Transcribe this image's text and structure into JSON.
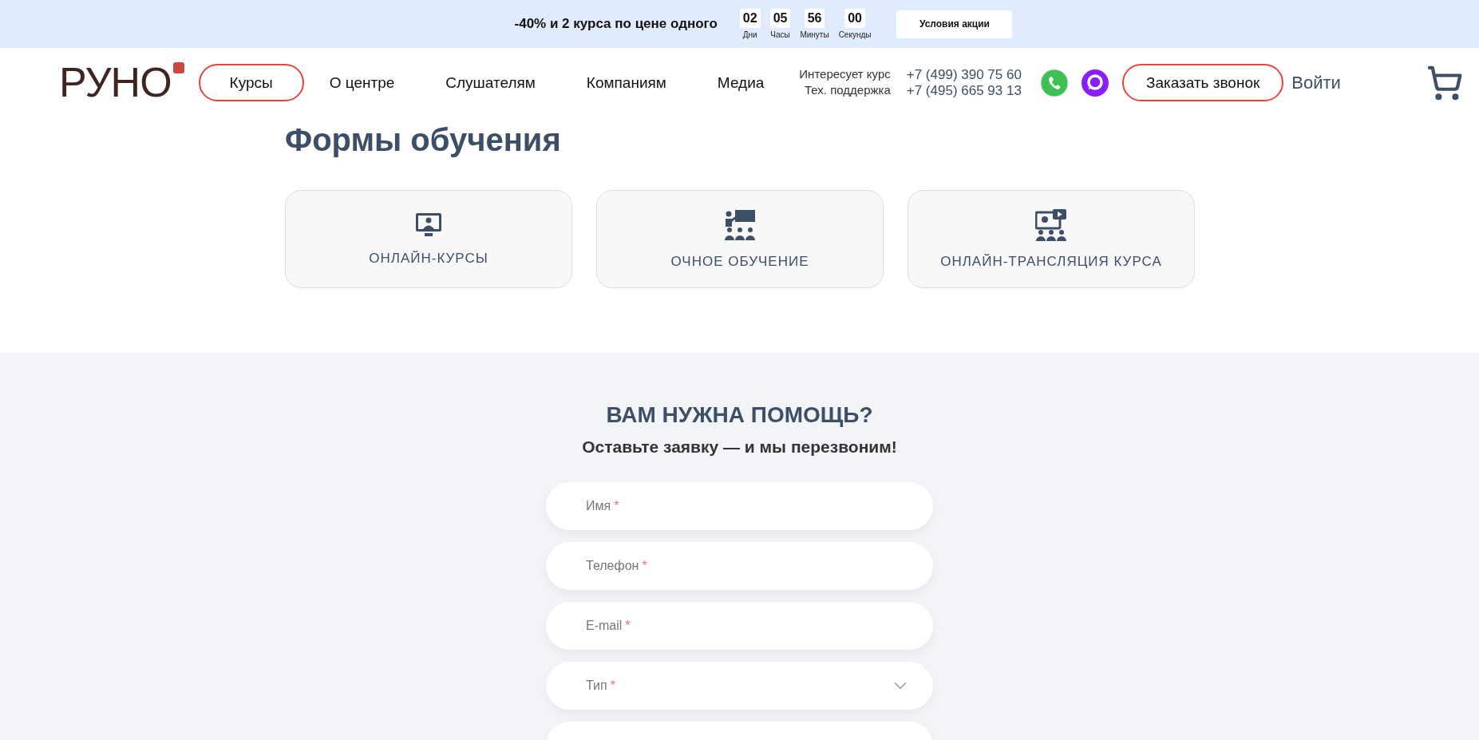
{
  "promo": {
    "text": "-40% и 2 курса по цене одного",
    "timer": [
      {
        "value": "02",
        "label": "Дни"
      },
      {
        "value": "05",
        "label": "Часы"
      },
      {
        "value": "56",
        "label": "Минуты"
      },
      {
        "value": "00",
        "label": "Секунды"
      }
    ],
    "button": "Условия акции"
  },
  "header": {
    "logo": "РУНО",
    "nav": [
      {
        "label": "Курсы",
        "selected": true
      },
      {
        "label": "О центре",
        "selected": false
      },
      {
        "label": "Слушателям",
        "selected": false
      },
      {
        "label": "Компаниям",
        "selected": false
      },
      {
        "label": "Медиа",
        "selected": false
      }
    ],
    "contacts": [
      {
        "label": "Интересует курс",
        "phone": "+7 (499) 390 75 60"
      },
      {
        "label": "Тех. поддержка",
        "phone": "+7 (495) 665 93 13"
      }
    ],
    "call_button": "Заказать звонок",
    "login": "Войти"
  },
  "learning_forms": {
    "title": "Формы обучения",
    "cards": [
      {
        "kind": "online",
        "label": "ОНЛАЙН-КУРСЫ"
      },
      {
        "kind": "classroom",
        "label": "ОЧНОЕ ОБУЧЕНИЕ"
      },
      {
        "kind": "stream",
        "label": "ОНЛАЙН-ТРАНСЛЯЦИЯ КУРСА"
      }
    ]
  },
  "help": {
    "title": "ВАМ НУЖНА ПОМОЩЬ?",
    "subtitle": "Оставьте заявку — и мы перезвоним!",
    "fields": [
      {
        "kind": "text",
        "placeholder": "Имя",
        "mark": "*"
      },
      {
        "kind": "text",
        "placeholder": "Телефон",
        "mark": "*"
      },
      {
        "kind": "text",
        "placeholder": "E-mail",
        "mark": "*"
      },
      {
        "kind": "select",
        "placeholder": "Тип",
        "mark": "*"
      },
      {
        "kind": "text"
      }
    ]
  }
}
